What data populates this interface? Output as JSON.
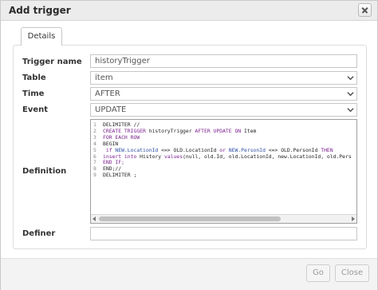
{
  "dialog": {
    "title": "Add trigger",
    "tab_label": "Details"
  },
  "form": {
    "trigger_name_label": "Trigger name",
    "trigger_name_value": "historyTrigger",
    "table_label": "Table",
    "table_value": "item",
    "time_label": "Time",
    "time_value": "AFTER",
    "event_label": "Event",
    "event_value": "UPDATE",
    "definition_label": "Definition",
    "definer_label": "Definer",
    "definer_value": ""
  },
  "definition_lines": [
    "1",
    "2",
    "3",
    "4",
    "5",
    "6",
    "7",
    "8",
    "9"
  ],
  "code": {
    "l1a": "DELIMITER //",
    "l2_create": "CREATE TRIGGER",
    "l2_name": " historyTrigger ",
    "l2_after": "AFTER UPDATE ON",
    "l2_table": " Item",
    "l3_for": "FOR EACH ROW",
    "l4_begin": "BEGIN",
    "l5_if": " if",
    "l5_new1": " NEW.LocationId",
    "l5_op1": " <=> OLD.LocationId ",
    "l5_or": "or",
    "l5_new2": " NEW.PersonId",
    "l5_op2": " <=> OLD.PersonId ",
    "l5_then": "THEN",
    "l6_insert": "insert into",
    "l6_rest": " History ",
    "l6_values": "values",
    "l6_args": "(null, old.Id, old.LocationId, new.LocationId, old.Pers",
    "l7_end": "END IF;",
    "l8_end": "END;//",
    "l9_delim": "DELIMITER ;"
  },
  "buttons": {
    "go_label": "Go",
    "close_label": "Close"
  }
}
